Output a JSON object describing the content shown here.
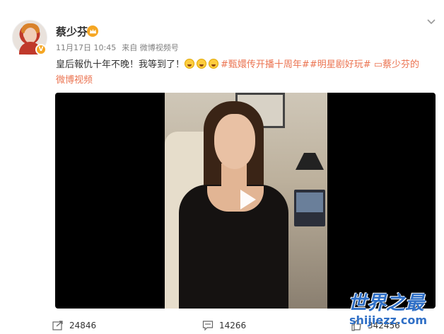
{
  "user": {
    "name": "蔡少芬",
    "verified_badge": "V"
  },
  "post": {
    "date": "11月17日 10:45",
    "source": "来自 微博视频号",
    "text": "皇后報仇十年不晚！我等到了！",
    "hashtag1": "#甄嬛传开播十周年#",
    "hashtag2": "#明星剧好玩#",
    "video_link": "蔡少芬的微博视频"
  },
  "actions": {
    "share_count": "24846",
    "comment_count": "14266",
    "like_count": "342456"
  },
  "watermark": {
    "title": "世界之最",
    "domain": "shijiezz.com"
  },
  "colors": {
    "link": "#eb7350",
    "meta": "#808080",
    "watermark": "#2f6fc6"
  }
}
